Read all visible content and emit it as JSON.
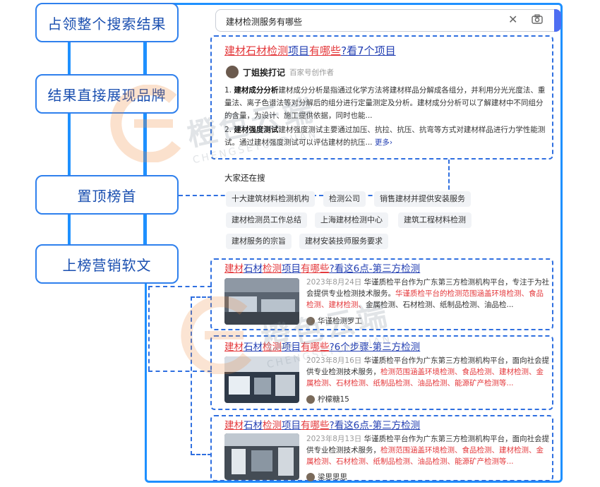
{
  "labels": [
    "占领整个搜索结果",
    "结果直接展现品牌",
    "置顶榜首",
    "上榜营销软文"
  ],
  "search": {
    "value": "建材检测服务有哪些",
    "clear_icon": "close-icon",
    "camera_icon": "camera-icon"
  },
  "top_result": {
    "title_parts": [
      {
        "t": "建材",
        "red": true
      },
      {
        "t": "石材检测",
        "red": true
      },
      {
        "t": "项目",
        "red": false
      },
      {
        "t": "有哪些",
        "red": true
      },
      {
        "t": "?看7个项目",
        "red": false
      }
    ],
    "author": "丁姐挨打记",
    "source": "百家号创作者",
    "items": [
      {
        "num": "1.",
        "bold": "建材成分分析",
        "text": "建材成分分析是指通过化学方法将建材样品分解成各组分，并利用分光光度法、重量法、离子色谱法等对分解后的组分进行定量测定及分析。建材成分分析可以了解建材中不同组分的含量，为设计、施工提供依据，同时也能..."
      },
      {
        "num": "2.",
        "bold": "建材强度测试",
        "text": "建材强度测试主要通过加压、抗拉、抗压、抗弯等方式对建材样品进行力学性能测试。通过建材强度测试可以评估建材的抗压...",
        "more": "更多"
      }
    ]
  },
  "related": {
    "heading": "大家还在搜",
    "chips": [
      "十大建筑材料检测机构",
      "检测公司",
      "销售建材并提供安装服务",
      "建材检测员工作总结",
      "上海建材检测中心",
      "建筑工程材料检测",
      "建材服务的宗旨",
      "建材安装技师服务要求"
    ]
  },
  "cards": [
    {
      "title_parts": [
        {
          "t": "建材",
          "red": true
        },
        {
          "t": "石材",
          "red": false
        },
        {
          "t": "检测",
          "red": true
        },
        {
          "t": "项目",
          "red": false
        },
        {
          "t": "有哪些",
          "red": true
        },
        {
          "t": "?看这6点-第三方检测",
          "red": false
        }
      ],
      "date": "2023年8月24日",
      "body": "华谨质检平台作为广东第三方检测机构平台，专注于为社会提供专业检测技术服务。",
      "red": "华谨质检平台的检测范围涵盖环境检测、食品检测、建材检测、",
      "body2": "金属检测、石材检测、纸制品检测、油品检...",
      "author": "华谨检测罗工"
    },
    {
      "title_parts": [
        {
          "t": "建材",
          "red": true
        },
        {
          "t": "石材",
          "red": false
        },
        {
          "t": "检测",
          "red": true
        },
        {
          "t": "项目",
          "red": false
        },
        {
          "t": "有哪些",
          "red": true
        },
        {
          "t": "?6个步骤-第三方检测",
          "red": false
        }
      ],
      "date": "2023年8月16日",
      "body": "华谨质检平台作为广东第三方检测机构平台，面向社会提供专业检测技术服务，",
      "red": "检测范围涵盖环境检测、食品检测、建材检测、金属检测、石材检测、纸制品检测、油品检测、能源矿产检测等...",
      "body2": "",
      "author": "柠檬糖15"
    },
    {
      "title_parts": [
        {
          "t": "建材",
          "red": true
        },
        {
          "t": "石材",
          "red": false
        },
        {
          "t": "检测",
          "red": true
        },
        {
          "t": "项目",
          "red": false
        },
        {
          "t": "有哪些",
          "red": true
        },
        {
          "t": "?看这6点-第三方检测",
          "red": false
        }
      ],
      "date": "2023年8月13日",
      "body": "华谨质检平台作为广东第三方检测机构平台，面向社会提供专业检测技术服务，",
      "red": "检测范围涵盖环境检测、食品检测、建材检测、金属检测、石材检测、纸制品检测、油品检测、能源矿产检测等...",
      "body2": "",
      "author": "梁思思思"
    }
  ],
  "watermark": {
    "cn": "橙色云端",
    "en": "CHENGSEYUNDUAN"
  },
  "colors": {
    "accent": "#1e90ff",
    "red": "#e4393c",
    "link": "#2440b3"
  }
}
